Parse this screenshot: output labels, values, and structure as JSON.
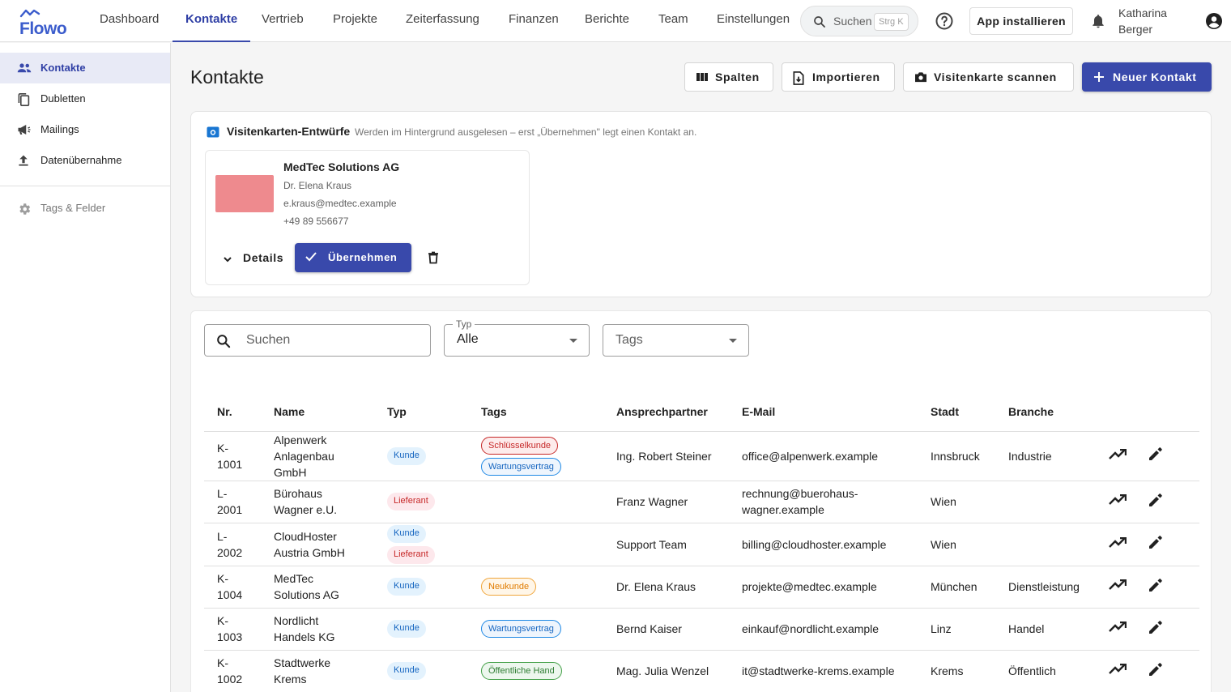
{
  "brand": "Flowo",
  "nav": [
    {
      "label": "Dashboard",
      "active": false
    },
    {
      "label": "Kontakte",
      "active": true
    },
    {
      "label": "Vertrieb",
      "active": false
    },
    {
      "label": "Projekte",
      "active": false
    },
    {
      "label": "Zeiterfassung",
      "active": false
    },
    {
      "label": "Finanzen",
      "active": false
    },
    {
      "label": "Berichte",
      "active": false
    },
    {
      "label": "Team",
      "active": false
    },
    {
      "label": "Einstellungen",
      "active": false
    }
  ],
  "search": {
    "label": "Suchen",
    "shortcut": "Strg K"
  },
  "install_label": "App installieren",
  "user": {
    "line1": "Katharina",
    "line2": "Berger"
  },
  "sidebar": {
    "items": [
      {
        "label": "Kontakte",
        "icon": "people-icon",
        "active": true
      },
      {
        "label": "Dubletten",
        "icon": "copy-icon",
        "active": false
      },
      {
        "label": "Mailings",
        "icon": "megaphone-icon",
        "active": false
      },
      {
        "label": "Datenübernahme",
        "icon": "upload-icon",
        "active": false
      }
    ],
    "settings_label": "Tags & Felder"
  },
  "page": {
    "title": "Kontakte"
  },
  "toolbar": {
    "columns_label": "Spalten",
    "import_label": "Importieren",
    "scan_label": "Visitenkarte scannen",
    "new_label": "Neuer Kontakt"
  },
  "drafts": {
    "title": "Visitenkarten-Entwürfe",
    "hint": "Werden im Hintergrund ausgelesen – erst „Übernehmen\" legt einen Kontakt an.",
    "card": {
      "company": "MedTec Solutions AG",
      "person": "Dr. Elena Kraus",
      "email": "e.kraus@medtec.example",
      "phone": "+49 89 556677",
      "details_label": "Details",
      "apply_label": "Übernehmen"
    }
  },
  "filters": {
    "search_placeholder": "Suchen",
    "type_label": "Typ",
    "type_value": "Alle",
    "tags_placeholder": "Tags"
  },
  "table": {
    "headers": [
      "Nr.",
      "Name",
      "Typ",
      "Tags",
      "Ansprechpartner",
      "E-Mail",
      "Stadt",
      "Branche"
    ],
    "rows": [
      {
        "nr": [
          "K-",
          "1001"
        ],
        "name": [
          "Alpenwerk",
          "Anlagenbau",
          "GmbH"
        ],
        "types": [
          "Kunde"
        ],
        "tags": [
          "Schlüsselkunde",
          "Wartungsvertrag"
        ],
        "contact": "Ing. Robert Steiner",
        "email": [
          "office@alpenwerk.example"
        ],
        "city": "Innsbruck",
        "industry": "Industrie"
      },
      {
        "nr": [
          "L-",
          "2001"
        ],
        "name": [
          "Bürohaus",
          "Wagner e.U."
        ],
        "types": [
          "Lieferant"
        ],
        "tags": [],
        "contact": "Franz Wagner",
        "email": [
          "rechnung@buerohaus-",
          "wagner.example"
        ],
        "city": "Wien",
        "industry": ""
      },
      {
        "nr": [
          "L-",
          "2002"
        ],
        "name": [
          "CloudHoster",
          "Austria GmbH"
        ],
        "types": [
          "Kunde",
          "Lieferant"
        ],
        "tags": [],
        "contact": "Support Team",
        "email": [
          "billing@cloudhoster.example"
        ],
        "city": "Wien",
        "industry": ""
      },
      {
        "nr": [
          "K-",
          "1004"
        ],
        "name": [
          "MedTec",
          "Solutions AG"
        ],
        "types": [
          "Kunde"
        ],
        "tags": [
          "Neukunde"
        ],
        "contact": "Dr. Elena Kraus",
        "email": [
          "projekte@medtec.example"
        ],
        "city": "München",
        "industry": "Dienstleistung"
      },
      {
        "nr": [
          "K-",
          "1003"
        ],
        "name": [
          "Nordlicht",
          "Handels KG"
        ],
        "types": [
          "Kunde"
        ],
        "tags": [
          "Wartungsvertrag"
        ],
        "contact": "Bernd Kaiser",
        "email": [
          "einkauf@nordlicht.example"
        ],
        "city": "Linz",
        "industry": "Handel"
      },
      {
        "nr": [
          "K-",
          "1002"
        ],
        "name": [
          "Stadtwerke",
          "Krems"
        ],
        "types": [
          "Kunde"
        ],
        "tags": [
          "Öffentliche Hand"
        ],
        "contact": "Mag. Julia Wenzel",
        "email": [
          "it@stadtwerke-krems.example"
        ],
        "city": "Krems",
        "industry": "Öffentlich"
      }
    ]
  },
  "colors": {
    "primary": "#3949ab",
    "accent_text": "#2f3fa5",
    "thumb": "#ee8a8e"
  }
}
